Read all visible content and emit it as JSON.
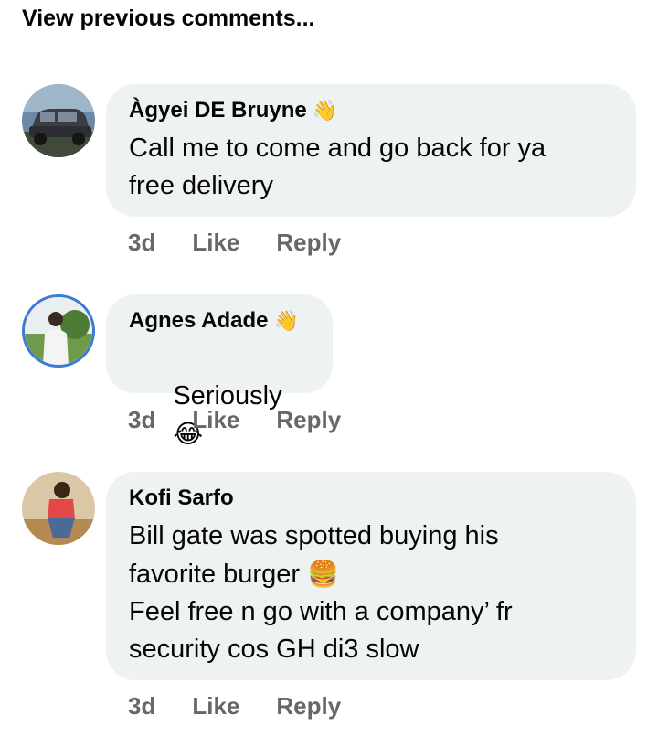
{
  "header": {
    "view_previous": "View previous comments..."
  },
  "comments": [
    {
      "author": "Àgyei DE Bruyne",
      "badge_icon": "wave-hand-icon",
      "text": "Call me to come and go back for ya\nfree delivery",
      "time": "3d",
      "like": "Like",
      "reply": "Reply",
      "avatar": "car-photo"
    },
    {
      "author": "Agnes Adade",
      "badge_icon": "wave-hand-icon",
      "text": "Seriously",
      "emoji": "😂",
      "time": "3d",
      "like": "Like",
      "reply": "Reply",
      "avatar": "woman-photo"
    },
    {
      "author": "Kofi Sarfo",
      "text_line1": "Bill gate was spotted buying his",
      "text_line2": "favorite burger",
      "emoji": "🍔",
      "text_line3": "Feel free n go with a company’ fr\nsecurity cos GH di3 slow",
      "time": "3d",
      "like": "Like",
      "reply": "Reply",
      "avatar": "man-photo"
    }
  ]
}
